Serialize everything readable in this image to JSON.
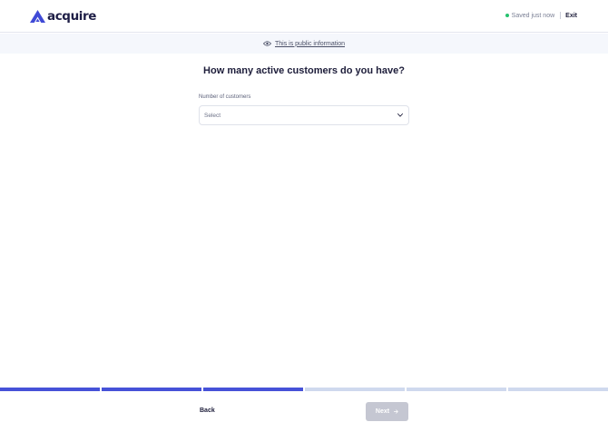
{
  "header": {
    "brand": "acquire",
    "saved_status": "Saved just now",
    "exit_label": "Exit",
    "status_color": "#25c26e",
    "brand_color": "#3f4ad6"
  },
  "banner": {
    "icon": "eye-icon",
    "text": "This is public information"
  },
  "main": {
    "question": "How many active customers do you have?",
    "field": {
      "label": "Number of customers",
      "value": "Select",
      "icon": "chevron-down-icon"
    }
  },
  "progress": {
    "total_steps": 6,
    "completed_steps": 3,
    "active_color": "#4652d8",
    "inactive_color": "#cfd9ee"
  },
  "footer": {
    "back_label": "Back",
    "next_label": "Next",
    "next_icon": "arrow-right-icon"
  }
}
